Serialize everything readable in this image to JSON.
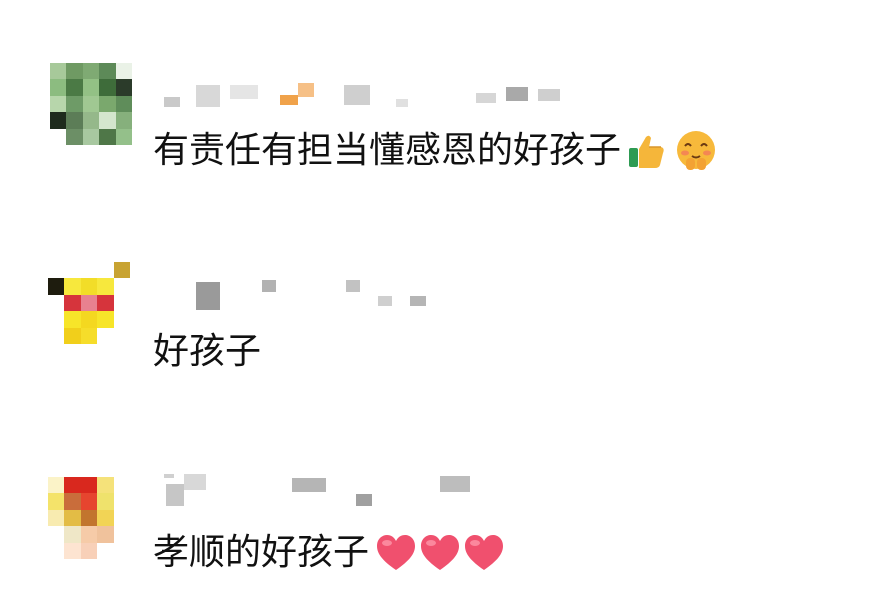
{
  "comments": [
    {
      "text": "有责任有担当懂感恩的好孩子",
      "emojis": [
        "thumbs-up-icon",
        "shy-face-icon"
      ]
    },
    {
      "text": "好孩子",
      "emojis": []
    },
    {
      "text": "孝顺的好孩子",
      "emojis": [
        "heart-icon",
        "heart-icon",
        "heart-icon"
      ]
    }
  ],
  "colors": {
    "text": "#111111",
    "heart": "#f0506e",
    "thumb": "#f5b63a",
    "face": "#f7b93b"
  }
}
